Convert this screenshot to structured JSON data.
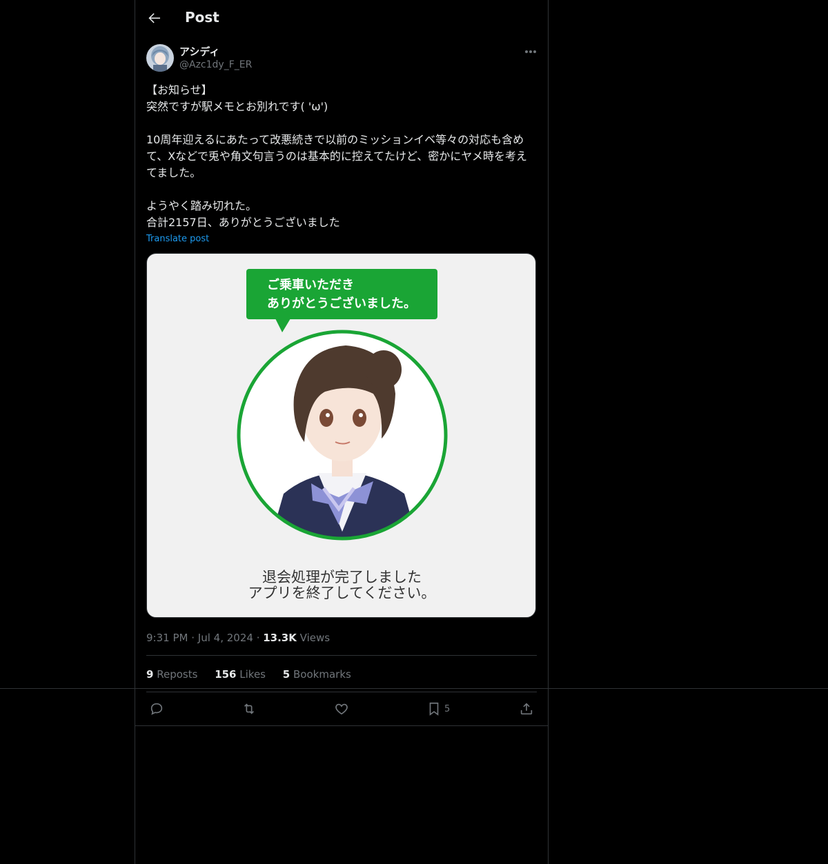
{
  "header": {
    "title": "Post"
  },
  "author": {
    "name": "アシディ",
    "handle": "@Azc1dy_F_ER"
  },
  "post": {
    "text": "【お知らせ】\n突然ですが駅メモとお別れです( 'ω')\n\n10周年迎えるにあたって改悪続きで以前のミッションイベ等々の対応も含めて、Xなどで兎や角文句言うのは基本的に控えてたけど、密かにヤメ時を考えてました。\n\nようやく踏み切れた。\n合計2157日、ありがとうございました",
    "translate_label": "Translate post"
  },
  "media": {
    "bubble_line1": "ご乗車いただき",
    "bubble_line2": "ありがとうございました。",
    "caption_line1": "退会処理が完了しました",
    "caption_line2": "アプリを終了してください。"
  },
  "meta": {
    "time": "9:31 PM",
    "date": "Jul 4, 2024",
    "views_count": "13.3K",
    "views_label": "Views"
  },
  "stats": {
    "reposts_count": "9",
    "reposts_label": "Reposts",
    "likes_count": "156",
    "likes_label": "Likes",
    "bookmarks_count": "5",
    "bookmarks_label": "Bookmarks"
  },
  "actions": {
    "bookmark_count": "5"
  },
  "colors": {
    "accent": "#1d9bf0",
    "bubble_green": "#1aa535",
    "ring_green": "#1aa535"
  }
}
